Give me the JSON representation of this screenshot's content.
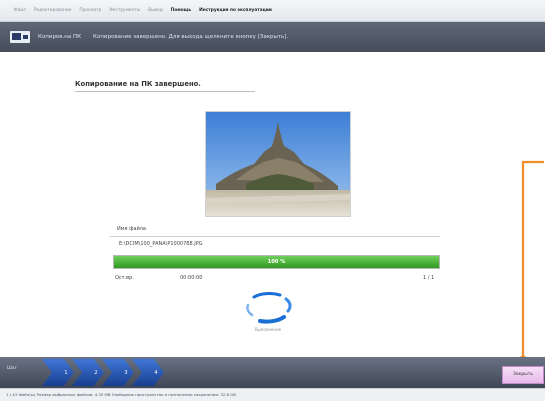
{
  "menu": {
    "items": [
      "Файл",
      "Редактирование",
      "Просмотр",
      "Инструменты",
      "Вывод",
      "Помощь",
      "Инструкция по эксплуатации"
    ],
    "active_index": 5
  },
  "titlebar": {
    "title": "Копиров.на ПК",
    "status": "Копирование завершено. Для выхода щелкните кнопку [Закрыть]."
  },
  "main": {
    "heading": "Копирование на ПК завершено.",
    "file_name_label": "Имя файла",
    "file_path": "E:\\DCIM\\100_PANA\\P1000788.JPG",
    "progress_percent": 100,
    "progress_text": "100 %",
    "remaining_label": "Ост.вр.",
    "remaining_time": "00:00:00",
    "file_count": "1 / 1",
    "spinner_label": "Выполнение"
  },
  "taskbar": {
    "first_step": "Шаг",
    "steps": [
      "1",
      "2",
      "3",
      "4"
    ],
    "close_label": "Закрыть"
  },
  "statusbar": {
    "text": "1 / 43 Файл(ы)   Размер выбранных файлов: 4.35 MB   Свободное пространство в назначении сохранения: 32.8 GB"
  },
  "colors": {
    "progress_green": "#3fae2e",
    "accent_orange": "#f08c2a",
    "close_button_pink": "#eabcec"
  },
  "icons": {
    "title_icon": "copy-to-pc-icon",
    "spinner": "loading-spinner-icon"
  }
}
